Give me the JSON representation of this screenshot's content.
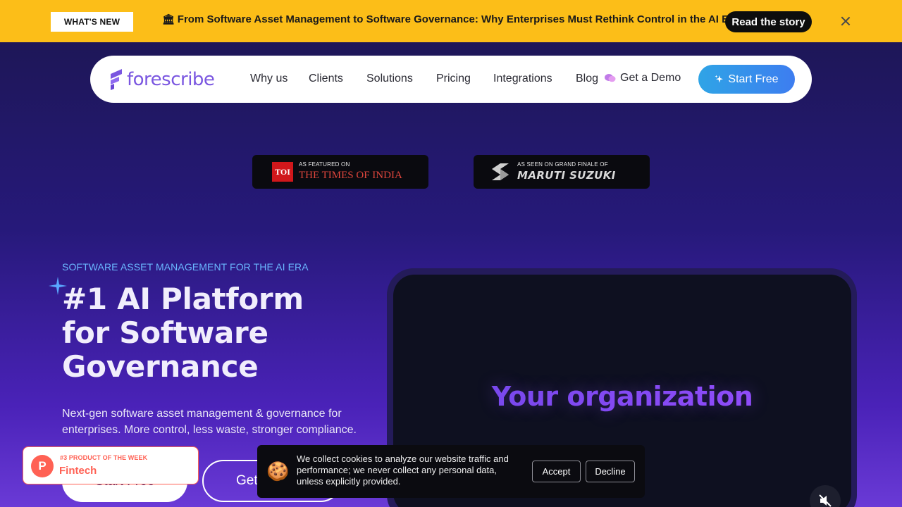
{
  "announcement": {
    "badge": "WHAT'S NEW",
    "icon_glyph": "🏛",
    "text": "From Software Asset Management to Software Governance: Why Enterprises Must Rethink Control in the AI Era",
    "cta": "Read the story",
    "bg_color": "#fcbe18"
  },
  "nav": {
    "brand": "forescribe",
    "links": [
      "Why us",
      "Clients",
      "Solutions",
      "Pricing",
      "Integrations",
      "Blog"
    ],
    "demo_label": "Get a Demo",
    "start_label": "Start Free"
  },
  "featured": {
    "toi": {
      "caption": "AS FEATURED ON",
      "logo_mark": "TOI",
      "name": "THE TIMES OF INDIA"
    },
    "maruti": {
      "caption": "AS SEEN ON GRAND FINALE OF",
      "name": "MARUTI SUZUKI"
    }
  },
  "hero": {
    "eyebrow": "SOFTWARE ASSET MANAGEMENT FOR THE AI ERA",
    "title": "#1 AI Platform for Software Governance",
    "subtitle": "Next-gen software asset management & governance for enterprises. More control, less waste, stronger compliance.",
    "primary_cta": "Start Free",
    "secondary_cta": "Get a Demo"
  },
  "video": {
    "caption": "Your organization"
  },
  "product_of_week": {
    "letter": "P",
    "rank": "#3 PRODUCT OF THE WEEK",
    "category": "Fintech"
  },
  "cookie": {
    "emoji": "🍪",
    "text": "We collect cookies to analyze our website traffic and performance; we never collect any personal data, unless explicitly provided.",
    "accept": "Accept",
    "decline": "Decline"
  }
}
